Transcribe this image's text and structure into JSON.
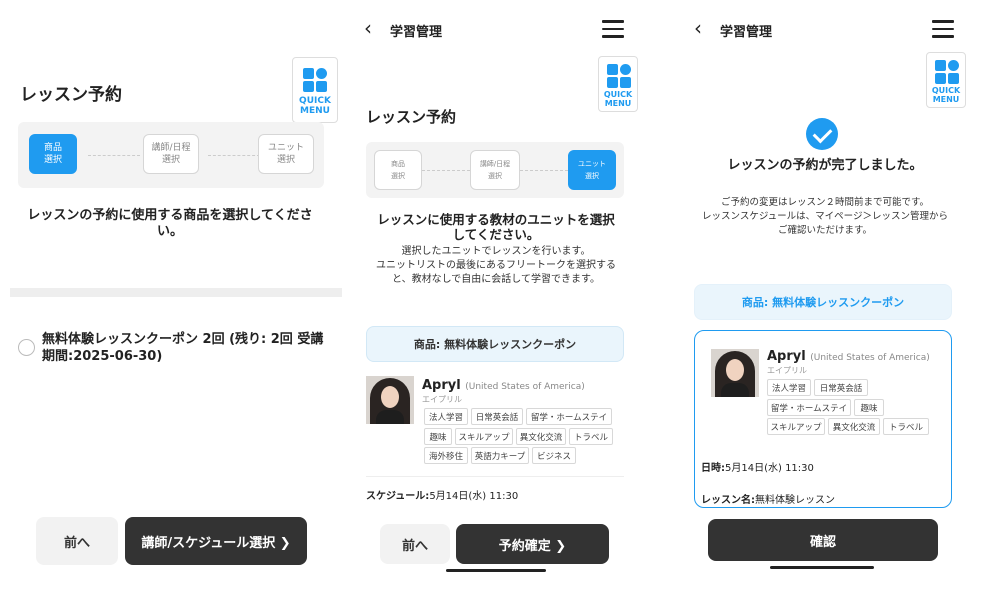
{
  "screen1": {
    "title": "レッスン予約",
    "quick_menu": [
      "QUICK",
      "MENU"
    ],
    "steps": [
      {
        "label": "商品\n選択",
        "active": true
      },
      {
        "label": "講師/日程\n選択",
        "active": false
      },
      {
        "label": "ユニット\n選択",
        "active": false
      }
    ],
    "heading": "レッスンの予約に使用する商品を選択してください。",
    "option_label": "無料体験レッスンクーポン 2回 (残り: 2回 受講期間:2025-06-30)",
    "prev_button": "前へ",
    "next_button": "講師/スケジュール選択 ❯"
  },
  "screen2": {
    "back_icon": "‹",
    "header_title": "学習管理",
    "quick_menu": [
      "QUICK",
      "MENU"
    ],
    "title": "レッスン予約",
    "steps": [
      {
        "label": "商品\n選択",
        "active": false
      },
      {
        "label": "講師/日程\n選択",
        "active": false
      },
      {
        "label": "ユニット\n選択",
        "active": true
      }
    ],
    "heading": "レッスンに使用する教材のユニットを選択してください。",
    "subtext": "選択したユニットでレッスンを行います。\nユニットリストの最後にあるフリートークを選択すると、教材なしで自由に会話して学習できます。",
    "product": "商品: 無料体験レッスンクーポン",
    "tutor": {
      "name": "Apryl",
      "country": "(United States of America)",
      "kana": "エイプリル",
      "tags": [
        "法人学習",
        "日常英会話",
        "留学・ホームステイ",
        "趣味",
        "スキルアップ",
        "異文化交流",
        "トラベル",
        "海外移住",
        "英語力キープ",
        "ビジネス"
      ]
    },
    "schedule_label": "スケジュール:",
    "schedule_value": "5月14日(水) 11:30",
    "prev_button": "前へ",
    "confirm_button": "予約確定 ❯"
  },
  "screen3": {
    "back_icon": "‹",
    "header_title": "学習管理",
    "quick_menu": [
      "QUICK",
      "MENU"
    ],
    "heading": "レッスンの予約が完了しました。",
    "subtext": "ご予約の変更はレッスン２時間前まで可能です。\nレッスンスケジュールは、マイページ＞レッスン管理からご確認いただけます。",
    "product": "商品: 無料体験レッスンクーポン",
    "tutor": {
      "name": "Apryl",
      "country": "(United States of America)",
      "kana": "エイプリル",
      "tags": [
        "法人学習",
        "日常英会話",
        "留学・ホームステイ",
        "趣味",
        "スキルアップ",
        "異文化交流",
        "トラベル"
      ]
    },
    "datetime_label": "日時:",
    "datetime_value": "5月14日(水) 11:30",
    "lesson_label": "レッスン名:",
    "lesson_value": "無料体験レッスン",
    "confirm_button": "確認"
  },
  "colors": {
    "accent": "#1f9bf0",
    "dark_button": "#333333",
    "light_button": "#f2f2f2",
    "product_bg": "#eaf5fc"
  }
}
